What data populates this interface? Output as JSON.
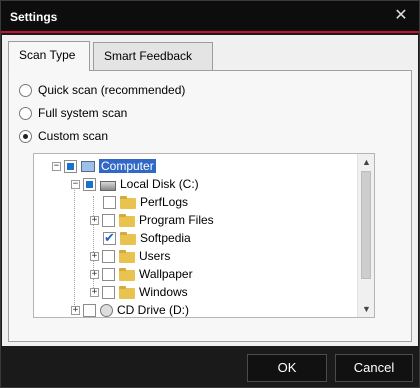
{
  "window": {
    "title": "Settings"
  },
  "tabs": [
    {
      "label": "Scan Type",
      "active": true
    },
    {
      "label": "Smart Feedback",
      "active": false
    }
  ],
  "scan_options": [
    {
      "label": "Quick scan (recommended)",
      "selected": false
    },
    {
      "label": "Full system scan",
      "selected": false
    },
    {
      "label": "Custom scan",
      "selected": true
    }
  ],
  "tree": {
    "root": "Computer",
    "local_disk": "Local Disk (C:)",
    "folders": [
      "PerfLogs",
      "Program Files",
      "Softpedia",
      "Users",
      "Wallpaper",
      "Windows"
    ],
    "cd_drive": "CD Drive (D:)"
  },
  "buttons": {
    "ok": "OK",
    "cancel": "Cancel"
  },
  "colors": {
    "accent": "#c8102e",
    "selection": "#3168c8",
    "window_bg": "#1a1a1a"
  },
  "icons": {
    "close": "✕",
    "scroll_up": "▲",
    "scroll_down": "▼",
    "expand": "+",
    "collapse": "−"
  }
}
